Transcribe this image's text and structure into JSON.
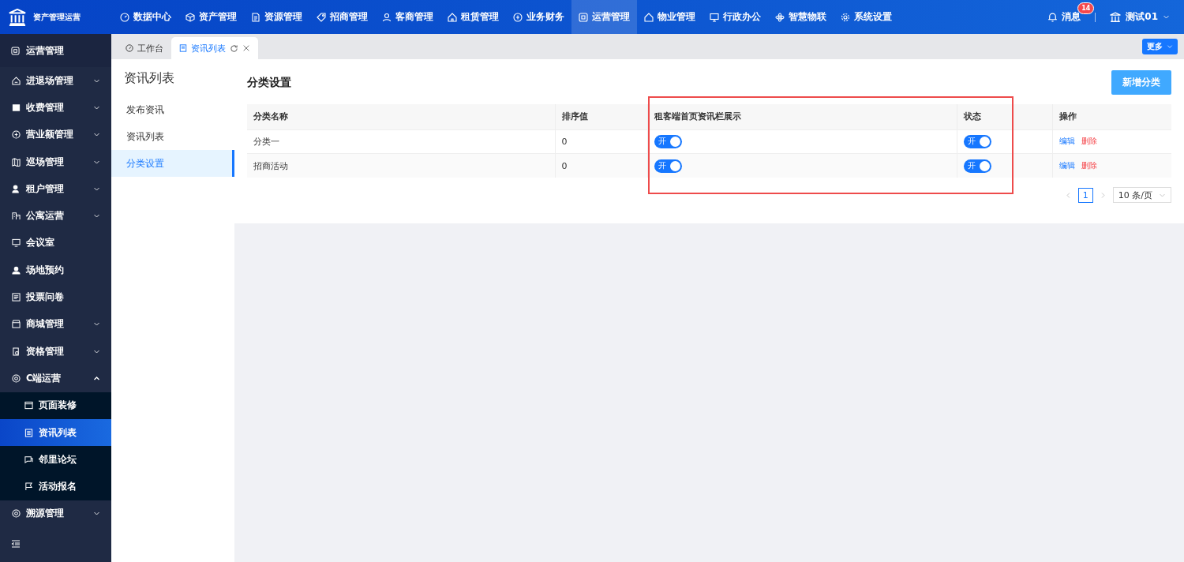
{
  "app": {
    "title": "资产管理运营"
  },
  "top_nav": [
    {
      "label": "数据中心",
      "selected": false
    },
    {
      "label": "资产管理",
      "selected": false
    },
    {
      "label": "资源管理",
      "selected": false
    },
    {
      "label": "招商管理",
      "selected": false
    },
    {
      "label": "客商管理",
      "selected": false
    },
    {
      "label": "租赁管理",
      "selected": false
    },
    {
      "label": "业务财务",
      "selected": false
    },
    {
      "label": "运营管理",
      "selected": true
    },
    {
      "label": "物业管理",
      "selected": false
    },
    {
      "label": "行政办公",
      "selected": false
    },
    {
      "label": "智慧物联",
      "selected": false
    },
    {
      "label": "系统设置",
      "selected": false
    }
  ],
  "header_right": {
    "messages": {
      "label": "消息",
      "badge": "14"
    },
    "user": {
      "name": "测试01"
    }
  },
  "sidebar": {
    "title": "运营管理",
    "items": [
      {
        "label": "进退场管理",
        "expanded": false
      },
      {
        "label": "收费管理",
        "expanded": false
      },
      {
        "label": "营业额管理",
        "expanded": false
      },
      {
        "label": "巡场管理",
        "expanded": false
      },
      {
        "label": "租户管理",
        "expanded": false
      },
      {
        "label": "公寓运营",
        "expanded": false
      },
      {
        "label": "会议室"
      },
      {
        "label": "场地预约"
      },
      {
        "label": "投票问卷"
      },
      {
        "label": "商城管理",
        "expanded": false
      },
      {
        "label": "资格管理",
        "expanded": false
      },
      {
        "label": "C端运营",
        "expanded": true,
        "children": [
          {
            "label": "页面装修",
            "selected": false
          },
          {
            "label": "资讯列表",
            "selected": true
          },
          {
            "label": "邻里论坛",
            "selected": false
          },
          {
            "label": "活动报名",
            "selected": false
          }
        ]
      },
      {
        "label": "溯源管理",
        "expanded": false
      }
    ]
  },
  "tabs": [
    {
      "label": "工作台",
      "selected": false
    },
    {
      "label": "资讯列表",
      "selected": true
    }
  ],
  "more_button": "更多",
  "sub_menu": {
    "title": "资讯列表",
    "items": [
      {
        "label": "发布资讯",
        "selected": false
      },
      {
        "label": "资讯列表",
        "selected": false
      },
      {
        "label": "分类设置",
        "selected": true
      }
    ]
  },
  "page": {
    "title": "分类设置",
    "add_button": "新增分类"
  },
  "table": {
    "columns": [
      "分类名称",
      "排序值",
      "租客端首页资讯栏展示",
      "状态",
      "操作"
    ],
    "rows": [
      {
        "name": "分类一",
        "sort": "0",
        "display": {
          "on": true,
          "label": "开"
        },
        "status": {
          "on": true,
          "label": "开"
        },
        "actions": [
          {
            "kind": "edit",
            "label": "编辑"
          },
          {
            "kind": "delete",
            "label": "删除"
          }
        ]
      },
      {
        "name": "招商活动",
        "sort": "0",
        "display": {
          "on": true,
          "label": "开"
        },
        "status": {
          "on": true,
          "label": "开"
        },
        "actions": [
          {
            "kind": "edit",
            "label": "编辑"
          },
          {
            "kind": "delete",
            "label": "删除"
          }
        ]
      }
    ]
  },
  "pagination": {
    "pages": [
      {
        "label": "1",
        "selected": true
      }
    ],
    "page_size": "10 条/页"
  }
}
